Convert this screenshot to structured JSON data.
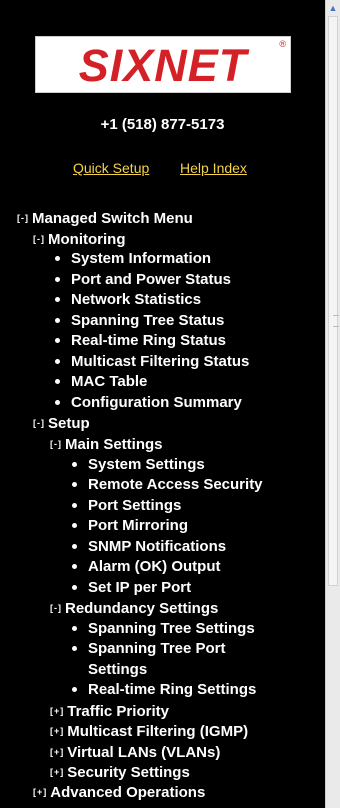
{
  "logo": {
    "text": "SIXNET",
    "mark": "®"
  },
  "phone": "+1 (518) 877-5173",
  "links": {
    "quick_setup": "Quick Setup",
    "help_index": "Help Index"
  },
  "toggles": {
    "collapse": "[-]",
    "expand": "[+]"
  },
  "menu": {
    "root": "Managed Switch Menu",
    "monitoring": {
      "label": "Monitoring",
      "items": [
        "System Information",
        "Port and Power Status",
        "Network Statistics",
        "Spanning Tree Status",
        "Real-time Ring Status",
        "Multicast Filtering Status",
        "MAC Table",
        "Configuration Summary"
      ]
    },
    "setup": {
      "label": "Setup",
      "main_settings": {
        "label": "Main Settings",
        "items": [
          "System Settings",
          "Remote Access Security",
          "Port Settings",
          "Port Mirroring",
          "SNMP Notifications",
          "Alarm (OK) Output",
          "Set IP per Port"
        ]
      },
      "redundancy_settings": {
        "label": "Redundancy Settings",
        "items": [
          "Spanning Tree Settings",
          "Spanning Tree Port",
          "Settings",
          "Real-time Ring Settings"
        ]
      },
      "traffic_priority": "Traffic Priority",
      "multicast_filtering": "Multicast Filtering (IGMP)",
      "vlans": "Virtual LANs (VLANs)",
      "security_settings": "Security Settings"
    },
    "advanced_operations": "Advanced Operations"
  },
  "colors": {
    "background": "#000000",
    "text": "#ffffff",
    "link": "#f3d34a",
    "brand_red": "#d42027"
  }
}
